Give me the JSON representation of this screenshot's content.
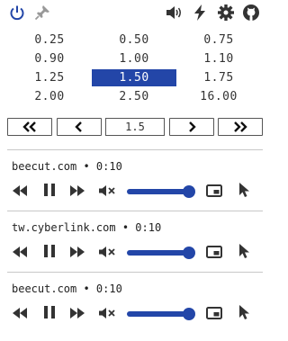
{
  "toolbar": {
    "icons": [
      "power-icon",
      "pin-icon",
      "volume-icon",
      "lightning-icon",
      "gear-icon",
      "github-icon"
    ]
  },
  "speed_options": [
    [
      "0.25",
      "0.50",
      "0.75"
    ],
    [
      "0.90",
      "1.00",
      "1.10"
    ],
    [
      "1.25",
      "1.50",
      "1.75"
    ],
    [
      "2.00",
      "2.50",
      "16.00"
    ]
  ],
  "selected_speed": "1.50",
  "nav": {
    "current_speed": "1.5",
    "buttons": [
      "fast-decrease",
      "decrease",
      "increase",
      "fast-increase"
    ]
  },
  "media": [
    {
      "title": "beecut.com • 0:10",
      "volume": 1.0
    },
    {
      "title": "tw.cyberlink.com • 0:10",
      "volume": 1.0
    },
    {
      "title": "beecut.com • 0:10",
      "volume": 1.0
    }
  ],
  "colors": {
    "accent": "#2346a8",
    "icon": "#333333"
  }
}
